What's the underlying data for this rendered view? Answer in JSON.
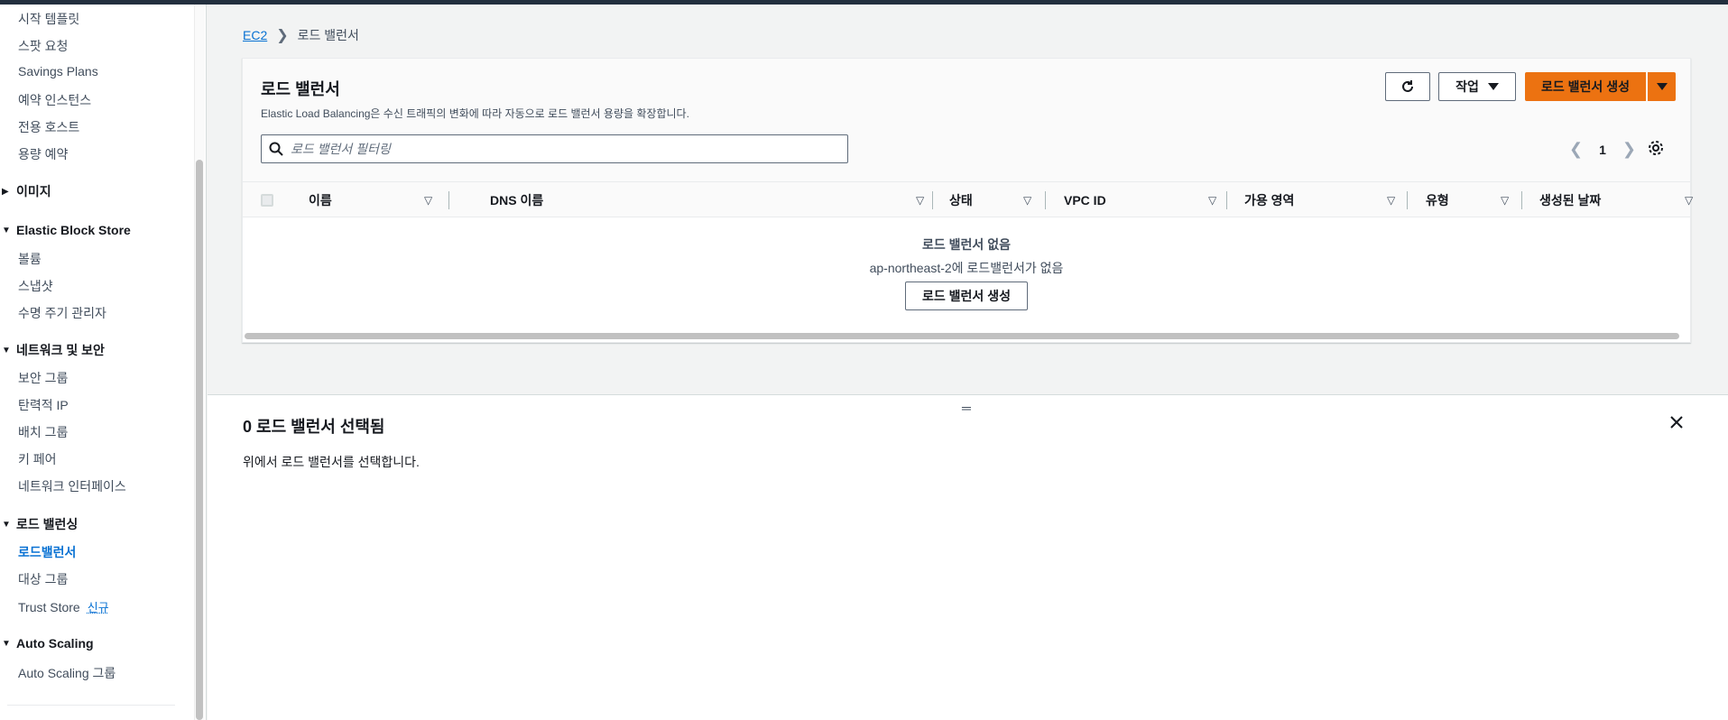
{
  "sidebar": {
    "items_top": [
      {
        "label": "시작 템플릿"
      },
      {
        "label": "스팟 요청"
      },
      {
        "label": "Savings Plans"
      },
      {
        "label": "예약 인스턴스"
      },
      {
        "label": "전용 호스트"
      },
      {
        "label": "용량 예약"
      }
    ],
    "sections": {
      "images": {
        "label": "이미지"
      },
      "ebs": {
        "label": "Elastic Block Store",
        "items": [
          {
            "label": "볼륨"
          },
          {
            "label": "스냅샷"
          },
          {
            "label": "수명 주기 관리자"
          }
        ]
      },
      "network": {
        "label": "네트워크 및 보안",
        "items": [
          {
            "label": "보안 그룹"
          },
          {
            "label": "탄력적 IP"
          },
          {
            "label": "배치 그룹"
          },
          {
            "label": "키 페어"
          },
          {
            "label": "네트워크 인터페이스"
          }
        ]
      },
      "lb": {
        "label": "로드 밸런싱",
        "items": [
          {
            "label": "로드밸런서"
          },
          {
            "label": "대상 그룹"
          },
          {
            "label": "Trust Store",
            "badge": "신규"
          }
        ]
      },
      "asg": {
        "label": "Auto Scaling",
        "items": [
          {
            "label": "Auto Scaling 그룹"
          }
        ]
      }
    }
  },
  "breadcrumb": {
    "root": "EC2",
    "current": "로드 밸런서"
  },
  "panel": {
    "title": "로드 밸런서",
    "description": "Elastic Load Balancing은 수신 트래픽의 변화에 따라 자동으로 로드 밸런서 용량을 확장합니다.",
    "actions_label": "작업",
    "create_label": "로드 밸런서 생성",
    "search_placeholder": "로드 밸런서 필터링",
    "page": "1",
    "columns": [
      "이름",
      "DNS 이름",
      "상태",
      "VPC ID",
      "가용 영역",
      "유형",
      "생성된 날짜"
    ],
    "empty_title": "로드 밸런서 없음",
    "empty_sub": "ap-northeast-2에 로드밸런서가 없음",
    "empty_button": "로드 밸런서 생성"
  },
  "split": {
    "title": "0 로드 밸런서 선택됨",
    "body": "위에서 로드 밸런서를 선택합니다."
  },
  "colors": {
    "accent": "#0972d3",
    "primary_button": "#ec7211",
    "top_bar": "#232f3e"
  }
}
